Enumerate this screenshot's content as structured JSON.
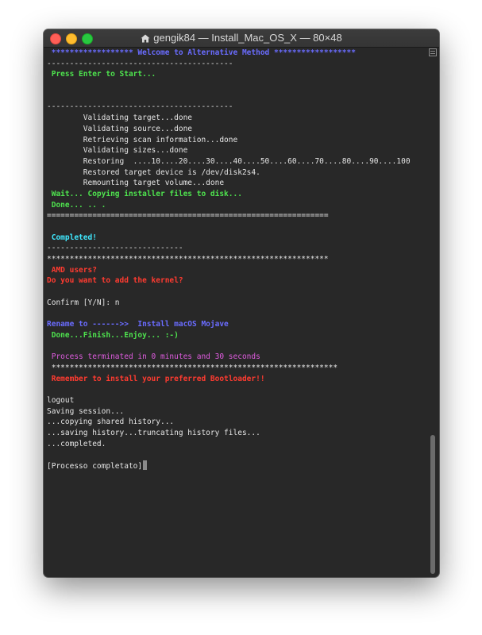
{
  "window": {
    "title": "gengik84 — Install_Mac_OS_X — 80×48",
    "icon": "home-icon"
  },
  "colors": {
    "background": "#282828",
    "blue": "#6a6cff",
    "green": "#4ee34e",
    "cyan": "#3fe9ff",
    "red": "#ff3b30",
    "magenta": "#e05ce0",
    "text": "#e6e6e6"
  },
  "terminal": {
    "lines": [
      {
        "text": " ****************** Welcome to Alternative Method ******************",
        "color": "blue"
      },
      {
        "text": "-----------------------------------------",
        "color": "white"
      },
      {
        "text": " Press Enter to Start...",
        "color": "green"
      },
      {
        "text": "",
        "color": "white"
      },
      {
        "text": "",
        "color": "white"
      },
      {
        "text": "-----------------------------------------",
        "color": "white"
      },
      {
        "text": "        Validating target...done",
        "color": "white"
      },
      {
        "text": "        Validating source...done",
        "color": "white"
      },
      {
        "text": "        Retrieving scan information...done",
        "color": "white"
      },
      {
        "text": "        Validating sizes...done",
        "color": "white"
      },
      {
        "text": "        Restoring  ....10....20....30....40....50....60....70....80....90....100",
        "color": "white"
      },
      {
        "text": "        Restored target device is /dev/disk2s4.",
        "color": "white"
      },
      {
        "text": "        Remounting target volume...done",
        "color": "white"
      },
      {
        "text": " Wait... Copying installer files to disk...",
        "color": "green"
      },
      {
        "text": " Done... .. .",
        "color": "green"
      },
      {
        "text": "==============================================================",
        "color": "white"
      },
      {
        "text": "",
        "color": "white"
      },
      {
        "text": " Completed!",
        "color": "cyan"
      },
      {
        "text": "------------------------------",
        "color": "white"
      },
      {
        "text": "**************************************************************",
        "color": "white"
      },
      {
        "text": " AMD users?",
        "color": "red"
      },
      {
        "text": "Do you want to add the kernel?",
        "color": "red"
      },
      {
        "text": "",
        "color": "white"
      },
      {
        "text": "Confirm [Y/N]: n",
        "color": "white"
      },
      {
        "text": "",
        "color": "white"
      },
      {
        "text": "Rename to ------>>  Install macOS Mojave",
        "color": "blue"
      },
      {
        "text": " Done...Finish...Enjoy... :-)",
        "color": "green"
      },
      {
        "text": "",
        "color": "white"
      },
      {
        "text": " Process terminated in 0 minutes and 30 seconds",
        "color": "magenta"
      },
      {
        "text": " ***************************************************************",
        "color": "white"
      },
      {
        "text": " Remember to install your preferred Bootloader!!",
        "color": "red"
      },
      {
        "text": "",
        "color": "white"
      },
      {
        "text": "logout",
        "color": "white"
      },
      {
        "text": "Saving session...",
        "color": "white"
      },
      {
        "text": "...copying shared history...",
        "color": "white"
      },
      {
        "text": "...saving history...truncating history files...",
        "color": "white"
      },
      {
        "text": "...completed.",
        "color": "white"
      },
      {
        "text": "",
        "color": "white"
      },
      {
        "text": "[Processo completato]",
        "color": "white",
        "cursor": true
      }
    ]
  },
  "scrollbar": {
    "position_fraction": 1.0,
    "visible_fraction": 0.27
  }
}
